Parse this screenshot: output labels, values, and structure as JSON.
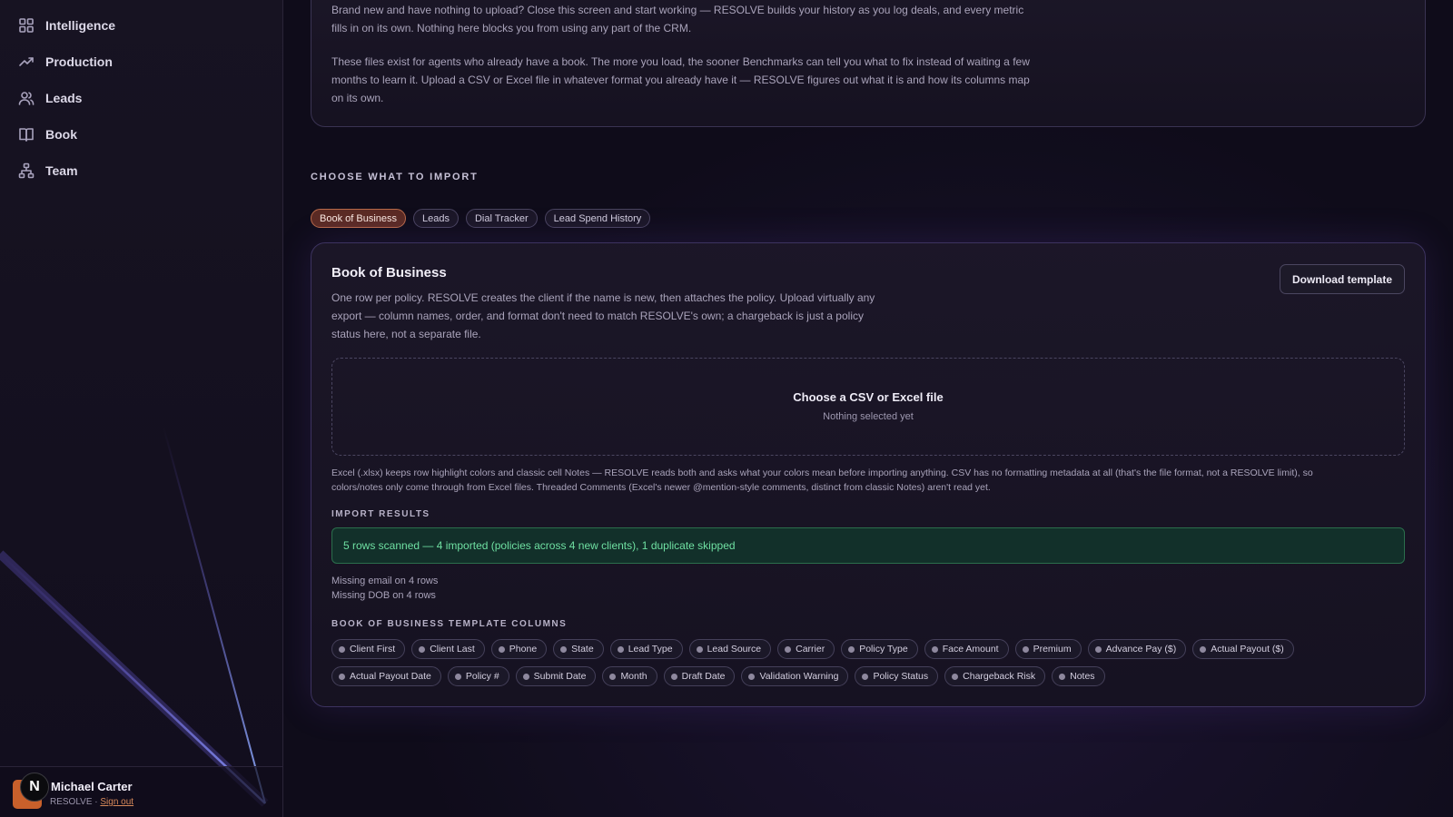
{
  "sidebar": {
    "items": [
      {
        "label": "Intelligence",
        "icon": "grid-icon"
      },
      {
        "label": "Production",
        "icon": "trend-icon"
      },
      {
        "label": "Leads",
        "icon": "users-icon"
      },
      {
        "label": "Book",
        "icon": "book-icon"
      },
      {
        "label": "Team",
        "icon": "org-icon"
      }
    ],
    "user": {
      "name": "Michael Carter",
      "org": "RESOLVE · ",
      "sign_out": "Sign out",
      "badge": "N"
    }
  },
  "intro": {
    "p1": "Brand new and have nothing to upload? Close this screen and start working — RESOLVE builds your history as you log deals, and every metric fills in on its own. Nothing here blocks you from using any part of the CRM.",
    "p2": "These files exist for agents who already have a book. The more you load, the sooner Benchmarks can tell you what to fix instead of waiting a few months to learn it. Upload a CSV or Excel file in whatever format you already have it — RESOLVE figures out what it is and how its columns map on its own."
  },
  "import": {
    "section_title": "CHOOSE WHAT TO IMPORT",
    "tabs": [
      "Book of Business",
      "Leads",
      "Dial Tracker",
      "Lead Spend History"
    ],
    "active_tab": "Book of Business",
    "card_title": "Book of Business",
    "card_desc": "One row per policy. RESOLVE creates the client if the name is new, then attaches the policy. Upload virtually any export — column names, order, and format don't need to match RESOLVE's own; a chargeback is just a policy status here, not a separate file.",
    "download_label": "Download template",
    "dropzone_title": "Choose a CSV or Excel file",
    "dropzone_sub": "Nothing selected yet",
    "note": "Excel (.xlsx) keeps row highlight colors and classic cell Notes — RESOLVE reads both and asks what your colors mean before importing anything. CSV has no formatting metadata at all (that's the file format, not a RESOLVE limit), so colors/notes only come through from Excel files. Threaded Comments (Excel's newer @mention-style comments, distinct from classic Notes) aren't read yet.",
    "results_label": "IMPORT RESULTS",
    "result_text": "5 rows scanned — 4 imported (policies across 4 new clients), 1 duplicate skipped",
    "warnings": [
      "Missing email on 4 rows",
      "Missing DOB on 4 rows"
    ],
    "columns_label": "BOOK OF BUSINESS TEMPLATE COLUMNS",
    "columns_row1": [
      "Client First",
      "Client Last",
      "Phone",
      "State",
      "Lead Type",
      "Lead Source",
      "Carrier",
      "Policy Type",
      "Face Amount",
      "Premium",
      "Advance Pay ($)",
      "Actual Payout ($)"
    ],
    "columns_row2": [
      "Actual Payout Date",
      "Policy #",
      "Submit Date",
      "Month",
      "Draft Date",
      "Validation Warning",
      "Policy Status",
      "Chargeback Risk",
      "Notes"
    ]
  }
}
